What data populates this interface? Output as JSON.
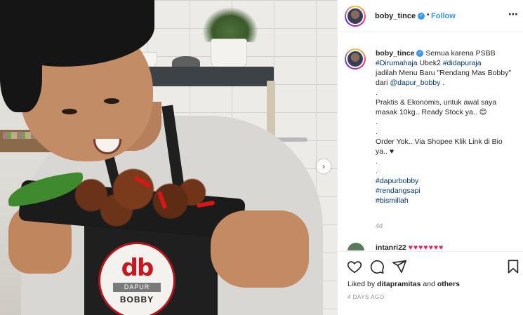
{
  "post": {
    "photo_logo": {
      "monogram": "db",
      "bar_text": "DAPUR",
      "name": "BOBBY"
    }
  },
  "header": {
    "username": "boby_tince",
    "verified_mark": "✓",
    "separator": "•",
    "follow_label": "Follow",
    "more_icon": "⋯"
  },
  "caption": {
    "username": "boby_tince",
    "line1": "Semua karena PSBB",
    "tag1": "#Dirumahaja",
    "text2": " Ubek2 ",
    "tag2": "#didapuraja",
    "text3": "jadilah Menu Baru \"Rendang Mas Bobby\" dari ",
    "mention": "@dapur_bobby",
    "text4": " .\n.\nPraktis & Ekonomis, untuk awal saya masak 10kg.. Ready Stock ya.. 😊\n.\n.\nOrder Yok.. Via Shopee Klik Link di Bio ya.. ♥\n.\n.\n",
    "tag3": "#dapurbobby",
    "tag4": "#rendangsapi",
    "tag5": "#bismillah",
    "time": "4d"
  },
  "comment2": {
    "username": "intanri22",
    "text": "♥♥♥♥♥♥♥"
  },
  "actions": {
    "liked_prefix": "Liked by ",
    "liked_user": "ditapramitas",
    "liked_mid": " and ",
    "liked_others": "others",
    "date": "4 DAYS AGO"
  },
  "icons": {
    "like": "heart-icon",
    "comment": "comment-icon",
    "share": "share-icon",
    "save": "bookmark-icon",
    "next": "chevron-right-icon"
  }
}
